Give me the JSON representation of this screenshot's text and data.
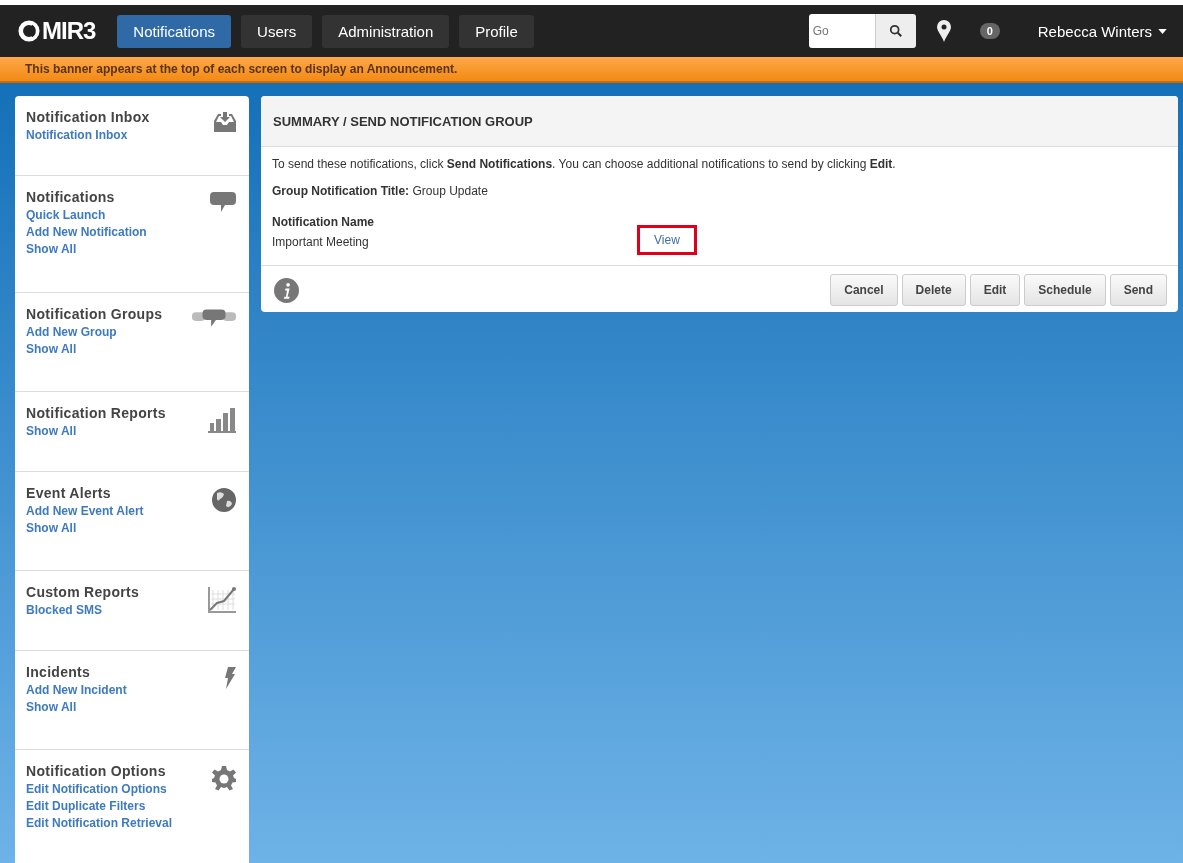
{
  "nav": {
    "logo": "MIR3",
    "tabs": [
      {
        "label": "Notifications",
        "selected": true
      },
      {
        "label": "Users",
        "selected": false
      },
      {
        "label": "Administration",
        "selected": false
      },
      {
        "label": "Profile",
        "selected": false
      }
    ],
    "search": {
      "placeholder": "Go"
    },
    "badge": "0",
    "user": "Rebecca Winters"
  },
  "banner": "This banner appears at the top of each screen to display an Announcement.",
  "sidebar": [
    {
      "kind": "inbox",
      "title": "Notification Inbox",
      "links": [
        "Notification Inbox"
      ]
    },
    {
      "kind": "chat",
      "title": "Notifications",
      "links": [
        "Quick Launch",
        "Add New Notification",
        "Show All"
      ]
    },
    {
      "kind": "group",
      "title": "Notification Groups",
      "links": [
        "Add New Group",
        "Show All"
      ]
    },
    {
      "kind": "reports",
      "title": "Notification Reports",
      "links": [
        "Show All"
      ]
    },
    {
      "kind": "alerts",
      "title": "Event Alerts",
      "links": [
        "Add New Event Alert",
        "Show All"
      ]
    },
    {
      "kind": "custom",
      "title": "Custom Reports",
      "links": [
        "Blocked SMS"
      ]
    },
    {
      "kind": "incidents",
      "title": "Incidents",
      "links": [
        "Add New Incident",
        "Show All"
      ]
    },
    {
      "kind": "options",
      "title": "Notification Options",
      "links": [
        "Edit Notification Options",
        "Edit Duplicate Filters",
        "Edit Notification Retrieval"
      ]
    }
  ],
  "panel": {
    "title": "SUMMARY / SEND NOTIFICATION GROUP",
    "instruction": "To send these notifications, click **Send Notifications**. You can choose additional notifications to send by clicking **Edit**.",
    "group_title_label": "Group Notification Title:",
    "group_title": "Group Update",
    "column_heading": "Notification Name",
    "rows": [
      {
        "name": "Important Meeting",
        "link": "View",
        "highlighted": true
      }
    ],
    "buttons": [
      "Cancel",
      "Delete",
      "Edit",
      "Schedule",
      "Send"
    ]
  }
}
